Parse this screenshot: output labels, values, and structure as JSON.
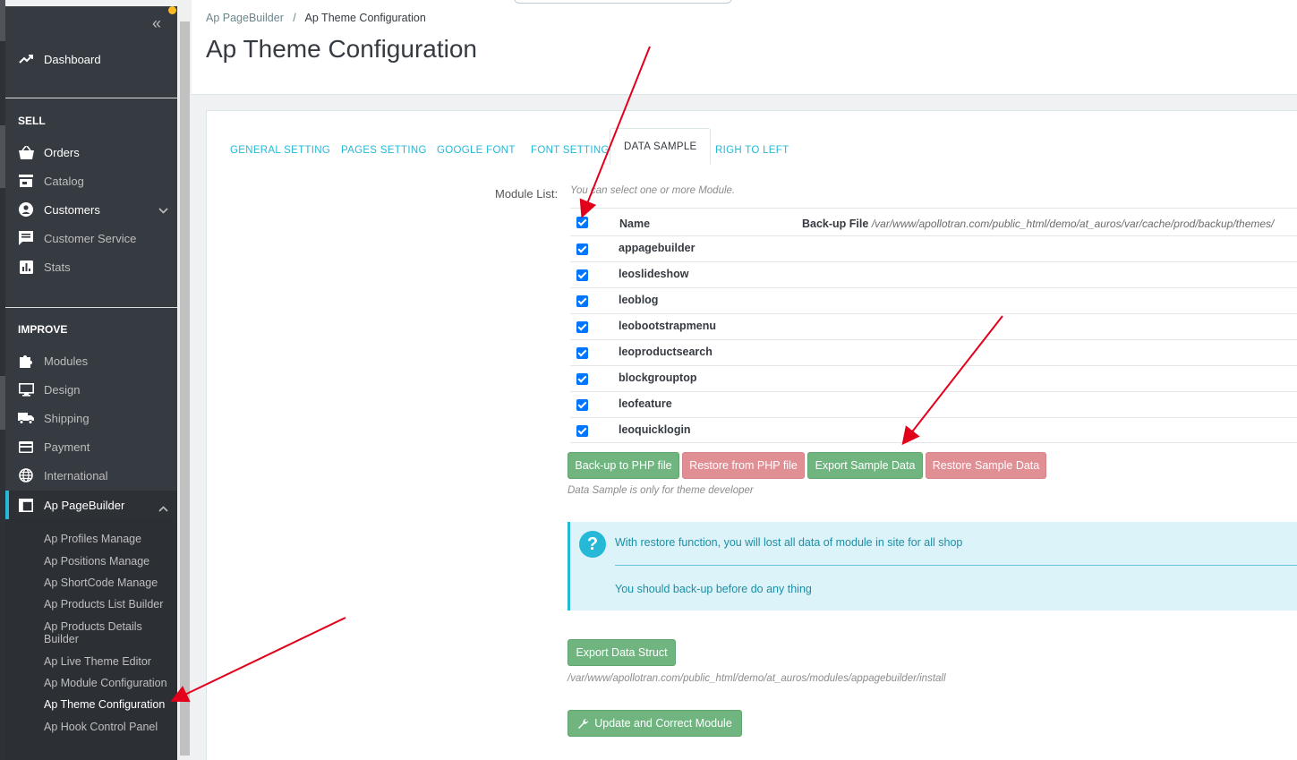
{
  "breadcrumb": {
    "parent": "Ap PageBuilder",
    "separator": "/",
    "current": "Ap Theme Configuration"
  },
  "page_title": "Ap Theme Configuration",
  "sidebar": {
    "collapse_glyph": "«",
    "dashboard": "Dashboard",
    "sell_heading": "SELL",
    "sell_items": [
      "Orders",
      "Catalog",
      "Customers",
      "Customer Service",
      "Stats"
    ],
    "improve_heading": "IMPROVE",
    "improve_items": [
      "Modules",
      "Design",
      "Shipping",
      "Payment",
      "International"
    ],
    "active_section": "Ap PageBuilder",
    "submenu": [
      "Ap Profiles Manage",
      "Ap Positions Manage",
      "Ap ShortCode Manage",
      "Ap Products List Builder",
      "Ap Products Details Builder",
      "Ap Live Theme Editor",
      "Ap Module Configuration",
      "Ap Theme Configuration",
      "Ap Hook Control Panel"
    ]
  },
  "tabs": [
    "GENERAL SETTING",
    "PAGES SETTING",
    "GOOGLE FONT",
    "FONT SETTING",
    "DATA SAMPLE",
    "RIGH TO LEFT"
  ],
  "active_tab": "DATA SAMPLE",
  "module_list": {
    "label": "Module List:",
    "help": "You can select one or more Module.",
    "col_name": "Name",
    "col_backup_label": "Back-up File",
    "col_backup_path": "/var/www/apollotran.com/public_html/demo/at_auros/var/cache/prod/backup/themes/",
    "modules": [
      "appagebuilder",
      "leoslideshow",
      "leoblog",
      "leobootstrapmenu",
      "leoproductsearch",
      "blockgrouptop",
      "leofeature",
      "leoquicklogin"
    ]
  },
  "buttons": {
    "backup": "Back-up to PHP file",
    "restore_php": "Restore from PHP file",
    "export_sample": "Export Sample Data",
    "restore_sample": "Restore Sample Data",
    "export_struct": "Export Data Struct",
    "update": "Update and Correct Module"
  },
  "data_sample_help": "Data Sample is only for theme developer",
  "alert": {
    "line1": "With restore function, you will lost all data of module in site for all shop",
    "line2": "You should back-up before do any thing",
    "icon": "?"
  },
  "struct_path": "/var/www/apollotran.com/public_html/demo/at_auros/modules/appagebuilder/install",
  "colors": {
    "accent": "#25b9d7",
    "green": "#70b580",
    "red": "#e08f95",
    "sidebar": "#363a41",
    "annotation": "#e3001b"
  },
  "icons": [
    "trending-up-icon",
    "shopping-basket-icon",
    "store-icon",
    "account-circle-icon",
    "chat-icon",
    "bar-chart-icon",
    "puzzle-icon",
    "desktop-icon",
    "truck-icon",
    "credit-card-icon",
    "globe-icon",
    "window-icon",
    "wrench-icon",
    "question-icon"
  ]
}
